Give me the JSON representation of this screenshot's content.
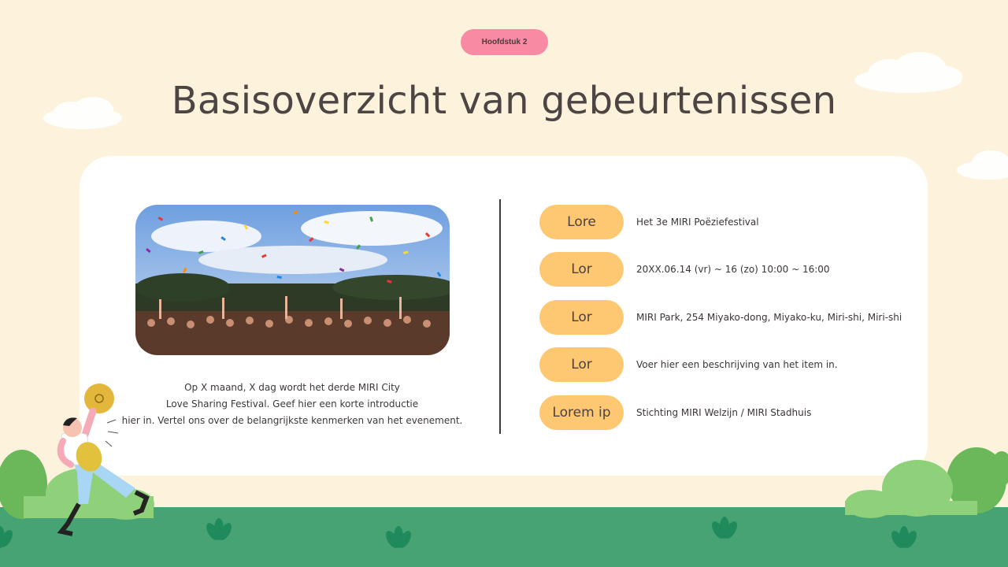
{
  "chapter_label": "Hoofdstuk 2",
  "title": "Basisoverzicht van gebeurtenissen",
  "description": [
    "Op X maand, X dag wordt het derde MIRI City",
    "Love Sharing Festival. Geef hier een korte introductie",
    "hier in. Vertel ons over de belangrijkste kenmerken van het evenement."
  ],
  "details": [
    {
      "label": "Lore",
      "text": "Het 3e MIRI Poëziefestival"
    },
    {
      "label": "Lor",
      "text": "20XX.06.14 (vr) ~ 16 (zo) 10:00 ~ 16:00"
    },
    {
      "label": "Lor",
      "text": "MIRI Park, 254 Miyako-dong, Miyako-ku, Miri-shi, Miri-shi"
    },
    {
      "label": "Lor",
      "text": "Voer hier een beschrijving van het item in."
    },
    {
      "label": "Lorem ip",
      "text": "Stichting MIRI Welzijn / MIRI Stadhuis"
    }
  ],
  "colors": {
    "background": "#fdf3dc",
    "chip": "#f98aa3",
    "pill": "#fec872",
    "ground": "#47a274",
    "bush_dark": "#6ab85a",
    "bush_light": "#8fd07a"
  },
  "icons": [
    "cloud-icon",
    "bush-icon",
    "cymbal-player-illustration",
    "festival-crowd-photo"
  ]
}
